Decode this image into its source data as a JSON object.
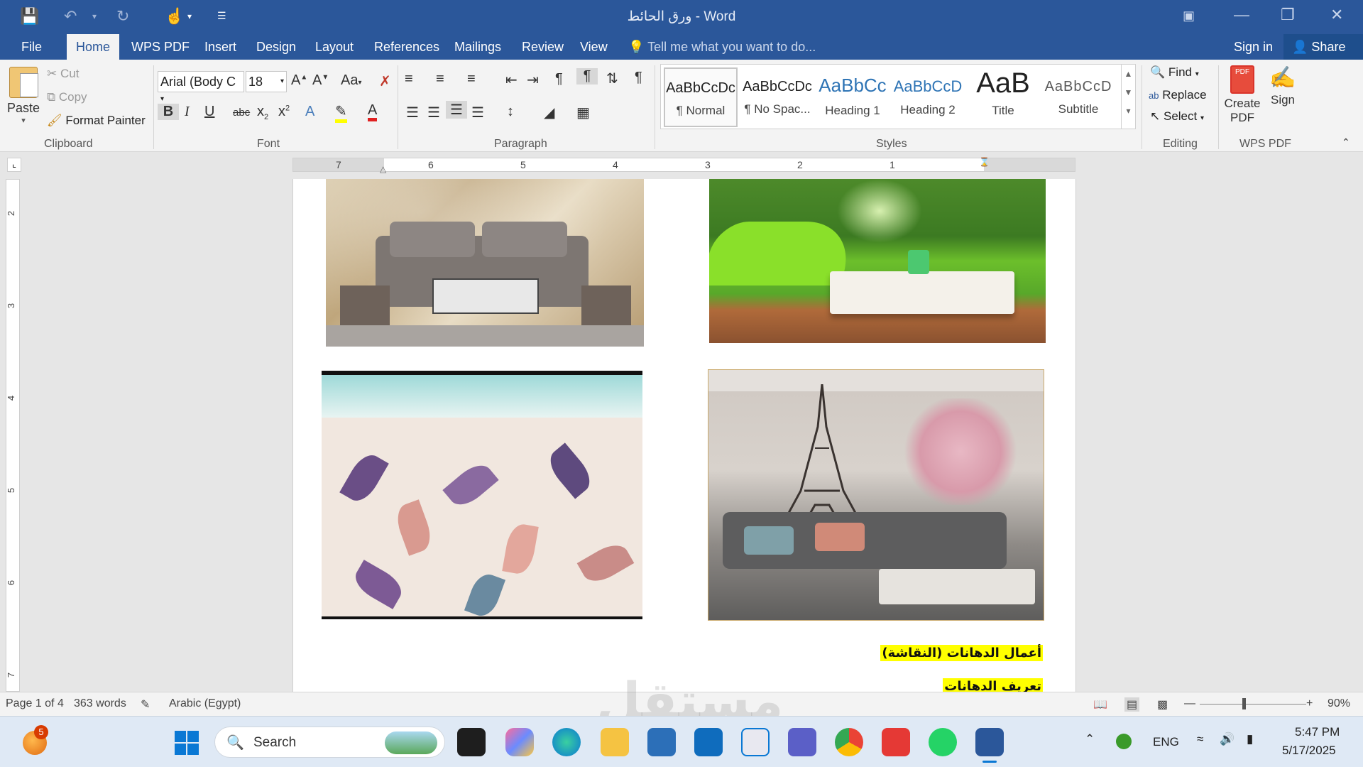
{
  "window": {
    "title": "ورق الحائط - Word"
  },
  "tabs": [
    "File",
    "Home",
    "WPS PDF",
    "Insert",
    "Design",
    "Layout",
    "References",
    "Mailings",
    "Review",
    "View"
  ],
  "tell_me": "Tell me what you want to do...",
  "account": {
    "sign_in": "Sign in",
    "share": "Share"
  },
  "clipboard": {
    "paste": "Paste",
    "cut": "Cut",
    "copy": "Copy",
    "format_painter": "Format Painter",
    "label": "Clipboard"
  },
  "font": {
    "name": "Arial (Body C",
    "size": "18",
    "label": "Font",
    "change_case": "Aa"
  },
  "paragraph": {
    "label": "Paragraph"
  },
  "styles": {
    "label": "Styles",
    "items": [
      {
        "sample": "AaBbCcDc",
        "name": "¶ Normal"
      },
      {
        "sample": "AaBbCcDc",
        "name": "¶ No Spac..."
      },
      {
        "sample": "AaBbCc",
        "name": "Heading 1"
      },
      {
        "sample": "AaBbCcD",
        "name": "Heading 2"
      },
      {
        "sample": "AaB",
        "name": "Title"
      },
      {
        "sample": "AaBbCcD",
        "name": "Subtitle"
      }
    ]
  },
  "editing": {
    "find": "Find",
    "replace": "Replace",
    "select": "Select",
    "label": "Editing"
  },
  "wps": {
    "create_pdf": "Create PDF",
    "sign": "Sign",
    "label": "WPS PDF"
  },
  "ruler": {
    "numbers": [
      "7",
      "6",
      "5",
      "4",
      "3",
      "2",
      "1"
    ],
    "vnumbers": [
      "2",
      "3",
      "4",
      "5",
      "6",
      "7"
    ]
  },
  "document": {
    "heading": "أعمال الدهانات (النقاشة)",
    "subheading": "تعريف الدهانات",
    "images": [
      "bedroom-wallpaper",
      "garden-wallpaper",
      "leaves-wallpaper",
      "eiffel-wallpaper"
    ]
  },
  "status": {
    "page": "Page 1 of 4",
    "words": "363 words",
    "language": "Arabic (Egypt)",
    "zoom": "90%"
  },
  "taskbar": {
    "search": "Search",
    "notification_count": "5",
    "lang": "ENG",
    "time": "5:47 PM",
    "date": "5/17/2025"
  },
  "watermark": "مستقل"
}
